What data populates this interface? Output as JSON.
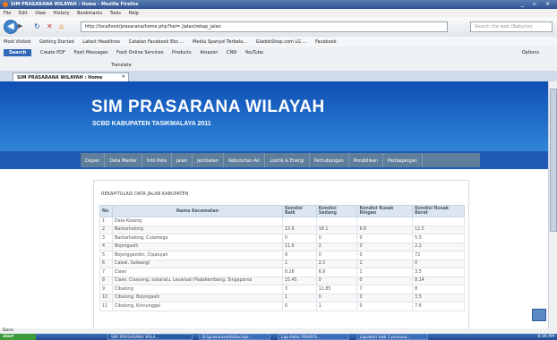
{
  "window": {
    "title": "SIM PRASARANA WILAYAH : Home - Mozilla Firefox"
  },
  "menubar": [
    "File",
    "Edit",
    "View",
    "History",
    "Bookmarks",
    "Tools",
    "Help"
  ],
  "navbar": {
    "url": "http://localhost/prasarana/home.php?hal=./jalan/rekap_jalan",
    "search_placeholder": "Search the web (Babylon)"
  },
  "bookmarks": [
    "Most Visited",
    "Getting Started",
    "Latest Headlines",
    "Catatan Facebook Eko ...",
    "Media Spanyol Terbela...",
    "GladokShop.com LG ...",
    "Facebook"
  ],
  "toolbar": {
    "search_label": "Search",
    "create_pdf": "Create PDF",
    "foxit_messages": "Foxit Messages",
    "foxit_online": "Foxit Online Services",
    "products": "Products",
    "amazon": "Amazon",
    "cnn": "CNN",
    "youtube": "YouTube",
    "options": "Options",
    "translate": "Translate"
  },
  "tab": {
    "label": "SIM PRASARANA WILAYAH : Home"
  },
  "header": {
    "title": "SIM PRASARANA WILAYAH",
    "subtitle": "SCBD KABUPATEN TASIKMALAYA 2011"
  },
  "nav": [
    "Depan",
    "Data Master",
    "Info Peta",
    "Jalan",
    "Jembatan",
    "Kebutuhan Air",
    "Listrik & Energi",
    "Perhubungan",
    "Pendidikan",
    "Perdagangan"
  ],
  "content": {
    "title": "REKAPITULASI DATA JALAN KABUPATEN",
    "columns": [
      "No",
      "Nama Kecamatan",
      "Kondisi Baik",
      "Kondisi Sedang",
      "Kondisi Rusak Ringan",
      "Kondisi Rusak Berat"
    ],
    "rows": [
      [
        "1",
        "Data Kosong",
        "",
        "",
        "",
        ""
      ],
      [
        "2",
        "Bantarkalong",
        "15.6",
        "18.1",
        "6.8",
        "11.5"
      ],
      [
        "3",
        "Bantarkalong, Culamega",
        "0",
        "0",
        "0",
        "5.5"
      ],
      [
        "4",
        "Bojongasih",
        "11.6",
        "2",
        "0",
        "2.2"
      ],
      [
        "5",
        "Bojonggambir, Cipatujah",
        "9",
        "0",
        "0",
        "72"
      ],
      [
        "6",
        "Cawal, Salwangi",
        "1",
        "2.5",
        "2",
        "0"
      ],
      [
        "7",
        "Ciawi",
        "8.26",
        "6.9",
        "1",
        "3.5"
      ],
      [
        "8",
        "Ciawi, Cisayong, sukaratu, Leuwisari Padakembang, Singaparna",
        "15.45",
        "0",
        "0",
        "8.14"
      ],
      [
        "9",
        "Cibalong",
        "3",
        "11.85",
        "7",
        "8"
      ],
      [
        "10",
        "Cibalong, Bojongasih",
        "1",
        "0",
        "0",
        "3.5"
      ],
      [
        "11",
        "Cibalong, Kinnunggal",
        "0",
        "1",
        "0",
        "7.6"
      ]
    ]
  },
  "status": "Done",
  "taskbar": {
    "start": "start",
    "items": [
      "SIM PRASARANA WILA...",
      "D:\\prasarana\\htdocs\\pr...",
      "Lap Akhir PRASYS...",
      "Lapakhir bab 1 prasara..."
    ],
    "clock": "8:36 AM"
  }
}
